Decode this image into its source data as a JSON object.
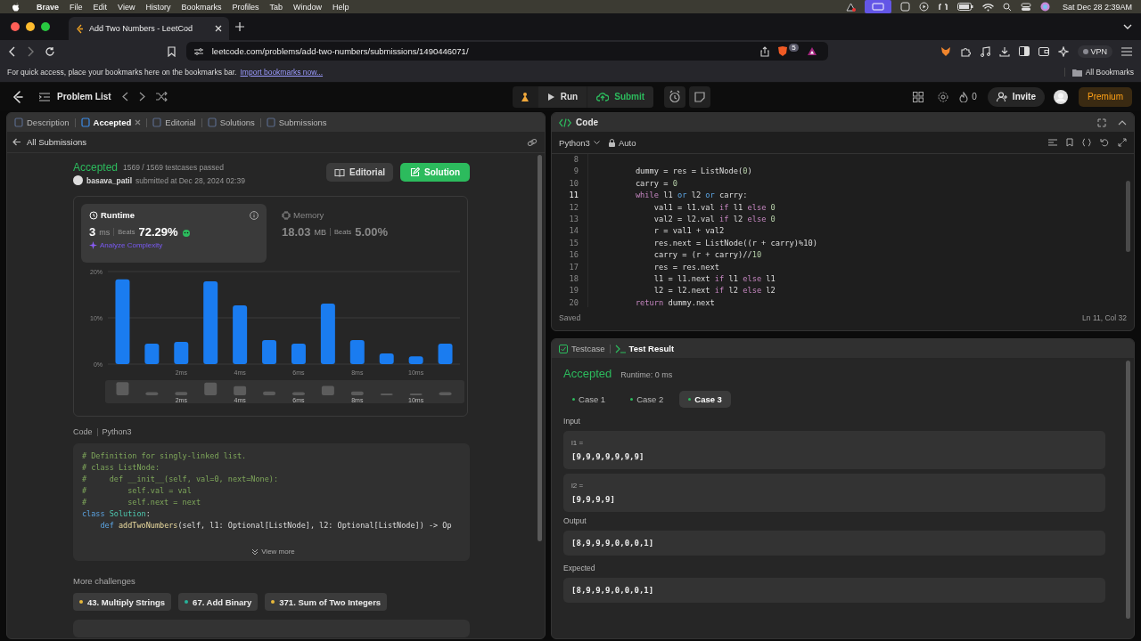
{
  "menu_bar": {
    "app": "Brave",
    "items": [
      "File",
      "Edit",
      "View",
      "History",
      "Bookmarks",
      "Profiles",
      "Tab",
      "Window",
      "Help"
    ],
    "clock": "Sat Dec 28  2:39AM"
  },
  "browser": {
    "tabs": [
      {
        "title": "Add Two Numbers - LeetCod",
        "selected": true
      }
    ],
    "url": "leetcode.com/problems/add-two-numbers/submissions/1490446071/",
    "shield_count": "5",
    "vpn": "VPN",
    "bookmarks_hint": "For quick access, place your bookmarks here on the bookmarks bar.",
    "bookmarks_link": "Import bookmarks now...",
    "all_bookmarks": "All Bookmarks"
  },
  "nav": {
    "problem_list": "Problem List",
    "run": "Run",
    "submit": "Submit",
    "streak": "0",
    "invite": "Invite",
    "premium": "Premium"
  },
  "left_panel": {
    "tabs": [
      {
        "label": "Description",
        "selected": false,
        "closable": false
      },
      {
        "label": "Accepted",
        "selected": true,
        "closable": true
      },
      {
        "label": "Editorial",
        "selected": false,
        "closable": false
      },
      {
        "label": "Solutions",
        "selected": false,
        "closable": false
      },
      {
        "label": "Submissions",
        "selected": false,
        "closable": false
      }
    ],
    "back": "All Submissions",
    "status": "Accepted",
    "testcases": "1569 / 1569 testcases passed",
    "user": "basava_patil",
    "submitted": "submitted at Dec 28, 2024 02:39",
    "editorial_button": "Editorial",
    "solution_button": "Solution",
    "stats": [
      {
        "title": "Runtime",
        "value": "3",
        "unit": "ms",
        "beats_label": "Beats",
        "beats": "72.29%",
        "analyze": "Analyze Complexity",
        "selected": true,
        "kind": "runtime"
      },
      {
        "title": "Memory",
        "value": "18.03",
        "unit": "MB",
        "beats_label": "Beats",
        "beats": "5.00%",
        "selected": false,
        "kind": "memory"
      }
    ],
    "chart_data": {
      "type": "bar",
      "x": [
        0,
        1,
        2,
        3,
        4,
        5,
        6,
        7,
        8,
        9,
        10,
        11
      ],
      "xlim": [
        -0.5,
        11.5
      ],
      "xticks": [
        {
          "value": 2,
          "label": "2ms"
        },
        {
          "value": 4,
          "label": "4ms"
        },
        {
          "value": 6,
          "label": "6ms"
        },
        {
          "value": 8,
          "label": "8ms"
        },
        {
          "value": 10,
          "label": "10ms"
        }
      ],
      "ylim": [
        0,
        20
      ],
      "yticks": [
        {
          "value": 0,
          "label": "0%"
        },
        {
          "value": 10,
          "label": "10%"
        },
        {
          "value": 20,
          "label": "20%"
        }
      ],
      "series": [
        {
          "color": "#1a7cf0",
          "values": [
            18.3,
            4.4,
            4.8,
            17.9,
            12.7,
            5.2,
            4.4,
            13.1,
            5.2,
            2.3,
            1.7,
            4.4
          ]
        }
      ]
    },
    "overview_labels": [
      "2ms",
      "4ms",
      "6ms",
      "8ms",
      "10ms"
    ],
    "code_label": "Code",
    "code_language": "Python3",
    "code_lines": [
      [
        {
          "text": "# Definition for singly-linked list.",
          "kind": "comment"
        }
      ],
      [
        {
          "text": "# class ListNode:",
          "kind": "comment"
        }
      ],
      [
        {
          "text": "#     def __init__(self, val=0, next=None):",
          "kind": "comment"
        }
      ],
      [
        {
          "text": "#         self.val = val",
          "kind": "comment"
        }
      ],
      [
        {
          "text": "#         self.next = next",
          "kind": "comment"
        }
      ],
      [
        {
          "text": "class ",
          "kind": "keyword"
        },
        {
          "text": "Solution",
          "kind": "type"
        },
        {
          "text": ":",
          "kind": "plain"
        }
      ],
      [
        {
          "text": "    def ",
          "kind": "keyword"
        },
        {
          "text": "addTwoNumbers",
          "kind": "func"
        },
        {
          "text": "(self, l1: Optional[ListNode], l2: Optional[ListNode]) -> Op",
          "kind": "plain"
        }
      ]
    ],
    "view_more": "View more",
    "more_title": "More challenges",
    "challenges": [
      {
        "label": "43. Multiply Strings",
        "color": "#e8b93a"
      },
      {
        "label": "67. Add Binary",
        "color": "#27b39a"
      },
      {
        "label": "371. Sum of Two Integers",
        "color": "#e8b93a"
      }
    ]
  },
  "editor": {
    "title": "Code",
    "language": "Python3",
    "mode": "Auto",
    "lines": [
      {
        "number": "8",
        "current": false
      },
      {
        "number": "9",
        "current": false,
        "segments": [
          {
            "text": "        dummy = res = ListNode(",
            "kind": "plain"
          },
          {
            "text": "0",
            "kind": "number"
          },
          {
            "text": ")",
            "kind": "plain"
          }
        ]
      },
      {
        "number": "10",
        "current": false,
        "segments": [
          {
            "text": "        carry = ",
            "kind": "plain"
          },
          {
            "text": "0",
            "kind": "number"
          }
        ]
      },
      {
        "number": "11",
        "current": true,
        "segments": [
          {
            "text": "        while",
            "kind": "control"
          },
          {
            "text": " l1 ",
            "kind": "plain"
          },
          {
            "text": "or",
            "kind": "keyword"
          },
          {
            "text": " l2 ",
            "kind": "plain"
          },
          {
            "text": "or",
            "kind": "keyword"
          },
          {
            "text": " carry:",
            "kind": "plain"
          }
        ]
      },
      {
        "number": "12",
        "current": false,
        "segments": [
          {
            "text": "            val1 = l1.val ",
            "kind": "plain"
          },
          {
            "text": "if",
            "kind": "control"
          },
          {
            "text": " l1 ",
            "kind": "plain"
          },
          {
            "text": "else ",
            "kind": "control"
          },
          {
            "text": "0",
            "kind": "number"
          }
        ]
      },
      {
        "number": "13",
        "current": false,
        "segments": [
          {
            "text": "            val2 = l2.val ",
            "kind": "plain"
          },
          {
            "text": "if",
            "kind": "control"
          },
          {
            "text": " l2 ",
            "kind": "plain"
          },
          {
            "text": "else ",
            "kind": "control"
          },
          {
            "text": "0",
            "kind": "number"
          }
        ]
      },
      {
        "number": "14",
        "current": false,
        "segments": [
          {
            "text": "            r = val1 + val2",
            "kind": "plain"
          }
        ]
      },
      {
        "number": "15",
        "current": false,
        "segments": [
          {
            "text": "            res.next = ListNode((r + carry)%10)",
            "kind": "plain"
          }
        ]
      },
      {
        "number": "16",
        "current": false,
        "segments": [
          {
            "text": "            carry = (r + carry)//",
            "kind": "plain"
          },
          {
            "text": "10",
            "kind": "number"
          }
        ]
      },
      {
        "number": "17",
        "current": false,
        "segments": [
          {
            "text": "            res = res.next",
            "kind": "plain"
          }
        ]
      },
      {
        "number": "18",
        "current": false,
        "segments": [
          {
            "text": "            l1 = l1.next ",
            "kind": "plain"
          },
          {
            "text": "if",
            "kind": "control"
          },
          {
            "text": " l1 ",
            "kind": "plain"
          },
          {
            "text": "else",
            "kind": "control"
          },
          {
            "text": " l1",
            "kind": "plain"
          }
        ]
      },
      {
        "number": "19",
        "current": false,
        "segments": [
          {
            "text": "            l2 = l2.next ",
            "kind": "plain"
          },
          {
            "text": "if",
            "kind": "control"
          },
          {
            "text": " l2 ",
            "kind": "plain"
          },
          {
            "text": "else",
            "kind": "control"
          },
          {
            "text": " l2",
            "kind": "plain"
          }
        ]
      },
      {
        "number": "20",
        "current": false,
        "segments": [
          {
            "text": "        return",
            "kind": "control"
          },
          {
            "text": " dummy.next",
            "kind": "plain"
          }
        ]
      }
    ],
    "status": "Saved",
    "cursor": "Ln 11, Col 32"
  },
  "results": {
    "tabs": [
      {
        "label": "Testcase",
        "selected": false
      },
      {
        "label": "Test Result",
        "selected": true
      }
    ],
    "verdict": "Accepted",
    "runtime": "Runtime: 0 ms",
    "cases": [
      {
        "label": "Case 1",
        "selected": false
      },
      {
        "label": "Case 2",
        "selected": false
      },
      {
        "label": "Case 3",
        "selected": true
      }
    ],
    "input_label": "Input",
    "inputs": [
      {
        "name": "l1 =",
        "value": "[9,9,9,9,9,9,9]"
      },
      {
        "name": "l2 =",
        "value": "[9,9,9,9]"
      }
    ],
    "output_label": "Output",
    "output": "[8,9,9,9,0,0,0,1]",
    "expected_label": "Expected",
    "expected": "[8,9,9,9,0,0,0,1]"
  }
}
